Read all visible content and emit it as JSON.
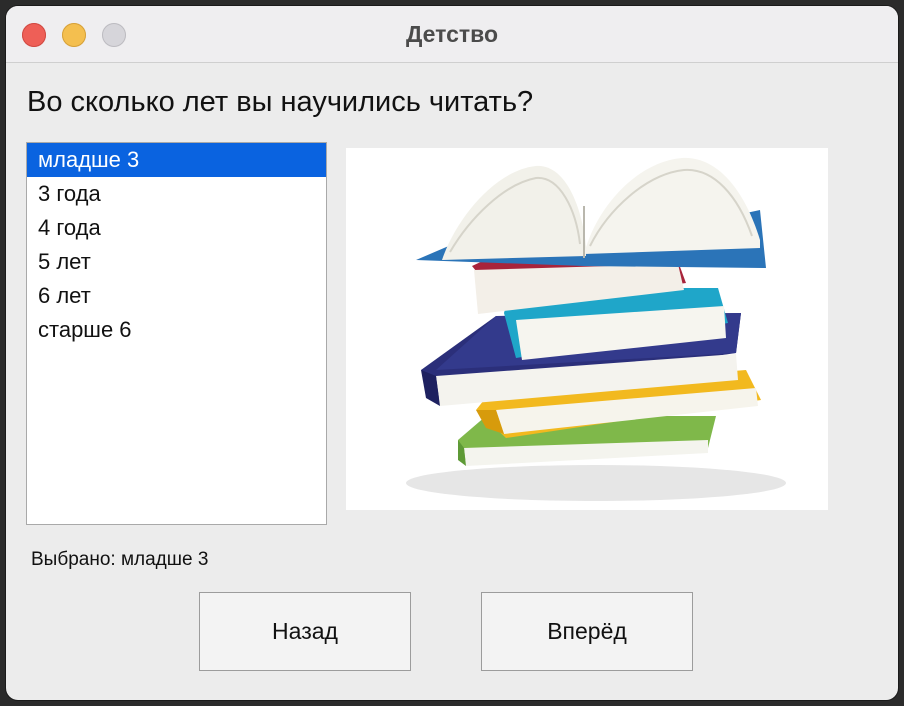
{
  "window": {
    "title": "Детство"
  },
  "question": "Во сколько лет вы научились читать?",
  "options": [
    {
      "label": "младше 3",
      "selected": true
    },
    {
      "label": "3 года",
      "selected": false
    },
    {
      "label": "4 года",
      "selected": false
    },
    {
      "label": "5 лет",
      "selected": false
    },
    {
      "label": "6 лет",
      "selected": false
    },
    {
      "label": "старше 6",
      "selected": false
    }
  ],
  "status_text": "Выбрано: младше 3",
  "buttons": {
    "back": "Назад",
    "next": "Вперёд"
  },
  "image": {
    "icon": "stack-of-books-illustration"
  },
  "colors": {
    "selection": "#0a63e0",
    "close": "#ee5f57",
    "minimize": "#f4bf4f",
    "maximize": "#d6d5da"
  }
}
